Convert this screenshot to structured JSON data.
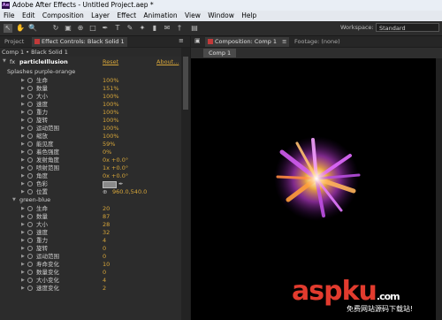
{
  "app": {
    "logo_text": "Ae",
    "title": "Adobe After Effects - Untitled Project.aep *"
  },
  "menu": [
    "File",
    "Edit",
    "Composition",
    "Layer",
    "Effect",
    "Animation",
    "View",
    "Window",
    "Help"
  ],
  "toolbar": {
    "workspace_label": "Workspace:",
    "workspace_value": "Standard"
  },
  "left_tabs": {
    "project": "Project",
    "effect_controls": "Effect Controls: Black Solid 1"
  },
  "breadcrumb": "Comp 1 • Black Solid 1",
  "effect": {
    "fx": "fx",
    "name": "particleIllusion",
    "reset": "Reset",
    "about": "About..."
  },
  "groups": [
    {
      "name": "Splashes purple-orange",
      "params": [
        {
          "label": "生命",
          "value": "100%"
        },
        {
          "label": "数量",
          "value": "151%"
        },
        {
          "label": "大小",
          "value": "100%"
        },
        {
          "label": "速度",
          "value": "100%"
        },
        {
          "label": "重力",
          "value": "100%"
        },
        {
          "label": "旋转",
          "value": "100%"
        },
        {
          "label": "运动范围",
          "value": "100%"
        },
        {
          "label": "缩放",
          "value": "100%"
        },
        {
          "label": "能见度",
          "value": "59%"
        },
        {
          "label": "着色强度",
          "value": "0%"
        },
        {
          "label": "发射角度",
          "value": "0x +0.0°"
        },
        {
          "label": "喷射范围",
          "value": "1x +0.0°"
        },
        {
          "label": "角度",
          "value": "0x +0.0°"
        },
        {
          "label": "色彩",
          "value": ""
        },
        {
          "label": "位置",
          "value": "960.0,540.0"
        }
      ]
    },
    {
      "name": "green-blue",
      "params": [
        {
          "label": "生命",
          "value": "20"
        },
        {
          "label": "数量",
          "value": "87"
        },
        {
          "label": "大小",
          "value": "28"
        },
        {
          "label": "速度",
          "value": "32"
        },
        {
          "label": "重力",
          "value": "4"
        },
        {
          "label": "旋转",
          "value": "0"
        },
        {
          "label": "运动范围",
          "value": "0"
        },
        {
          "label": "寿命变化",
          "value": "10"
        },
        {
          "label": "数量变化",
          "value": "0"
        },
        {
          "label": "大小变化",
          "value": "4"
        },
        {
          "label": "速度变化",
          "value": "2"
        }
      ]
    }
  ],
  "right_tabs": {
    "composition": "Composition: Comp 1",
    "footage": "Footage: (none)"
  },
  "comp_subtab": "Comp 1",
  "watermark": {
    "main": "aspku",
    "suffix": ".com",
    "sub": "免费网站源码下载站!"
  },
  "colors": {
    "accent_value": "#d7a63a",
    "panel": "#2c2c2c",
    "viewer": "#000000"
  }
}
